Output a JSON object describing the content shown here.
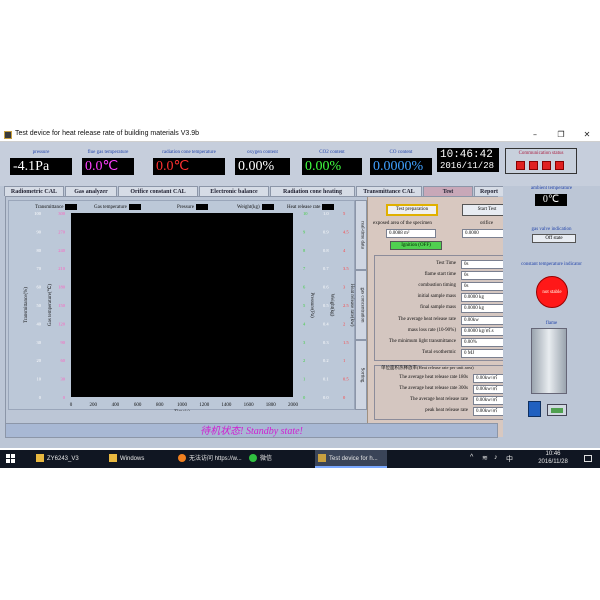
{
  "window": {
    "title": "Test device for heat release rate of building materials V3.9b",
    "controls": [
      "–",
      "❐",
      "✕"
    ]
  },
  "gauges": [
    {
      "label": "pressure",
      "value": "-4.1Pa",
      "color": "#ffffff"
    },
    {
      "label": "flue gas temperature",
      "value": "0.0℃",
      "color": "#ff40ff"
    },
    {
      "label": "radiation cone temperature",
      "value": "0.0℃",
      "color": "#ff3030"
    },
    {
      "label": "oxygen content",
      "value": "0.00%",
      "color": "#ffffff"
    },
    {
      "label": "CO2 content",
      "value": "0.00%",
      "color": "#40ff40"
    },
    {
      "label": "CO content",
      "value": "0.0000%",
      "color": "#40a0ff"
    }
  ],
  "clock": {
    "time": "10:46:42",
    "date": "2016/11/28"
  },
  "comm_status": {
    "label": "Communication status"
  },
  "tabs": [
    "Radiometric CAL",
    "Gas analyzer",
    "Orifice constant CAL",
    "Electronic balance",
    "Radiation cone heating",
    "Transmittance CAL",
    "Test",
    "Report"
  ],
  "active_tab": "Test",
  "chart": {
    "legend": [
      "Transmittance",
      "Gas temperature",
      "Pressure",
      "Weight(kg)",
      "Heat release rate"
    ],
    "xlabel": "Time(s)",
    "y_left_labels": [
      "Transmittance(%)",
      "Gas temperature(℃)"
    ],
    "y_right_labels": [
      "Pressure(Pa)",
      "Weight(kg)",
      "Heat release rate(kw)"
    ]
  },
  "chart_data": {
    "type": "line",
    "title": "",
    "xlabel": "Time(s)",
    "x_ticks": [
      0,
      200,
      400,
      600,
      800,
      1000,
      1200,
      1400,
      1600,
      1800,
      2000
    ],
    "xlim": [
      0,
      2000
    ],
    "y_axes": [
      {
        "label": "Transmittance(%)",
        "ticks": [
          0,
          10,
          20,
          30,
          40,
          50,
          60,
          70,
          80,
          90,
          100
        ],
        "color": "#ffffff"
      },
      {
        "label": "Gas temperature(℃)",
        "ticks": [
          0,
          30,
          60,
          90,
          120,
          150,
          180,
          210,
          240,
          270,
          300
        ],
        "color": "#ff60c0"
      },
      {
        "label": "Pressure(Pa)",
        "ticks": [
          0,
          1,
          2,
          3,
          4,
          5,
          6,
          7,
          8,
          9,
          10
        ],
        "color": "#40d040"
      },
      {
        "label": "Weight(kg)",
        "ticks": [
          "0.0",
          "0.1",
          "0.2",
          "0.3",
          "0.4",
          "0.5",
          "0.6",
          "0.7",
          "0.8",
          "0.9",
          "1.0"
        ],
        "color": "#ffffff"
      },
      {
        "label": "Heat release rate(kw)",
        "ticks": [
          "0",
          "0.5",
          "1",
          "1.5",
          "2",
          "2.5",
          "3",
          "3.5",
          "4",
          "4.5",
          "5"
        ],
        "color": "#ff4040"
      }
    ],
    "series": []
  },
  "vtabs": [
    "real-time data",
    "gas concentration",
    "Sorting"
  ],
  "test_panel": {
    "test_prep_btn": "Test preparation",
    "start_test_btn": "Start Test",
    "area_label": "exposed area of the specimen",
    "area_value": "0.0088 m²",
    "orifice_label": "orifice",
    "orifice_value": "0.0000",
    "ignition_btn": "Ignition (OFF)",
    "rows": [
      {
        "label": "Test Time",
        "value": "0s"
      },
      {
        "label": "flame start time",
        "value": "0s"
      },
      {
        "label": "combustion timing",
        "value": "0s"
      },
      {
        "label": "initial sample mass",
        "value": "0.0000 kg"
      },
      {
        "label": "final sample mass",
        "value": "0.0000 kg"
      },
      {
        "label": "The average heat release rate",
        "value": "0.00kw"
      },
      {
        "label": "mass loss rate (10-90%)",
        "value": "0.0000 kg/㎡.s"
      },
      {
        "label": "The minimum light transmittance",
        "value": "0.00%"
      },
      {
        "label": "Total exothermic",
        "value": "0 MJ"
      }
    ],
    "unit_area_title": "单位面积热释放率(Heat release rate per unit area)",
    "unit_area_rows": [
      {
        "label": "The average heat release rate 180s",
        "value": "0.00kw/㎡"
      },
      {
        "label": "The average heat release rate 300s",
        "value": "0.00kw/㎡"
      },
      {
        "label": "The average heat release rate",
        "value": "0.00kw/㎡"
      },
      {
        "label": "peak heat release rate",
        "value": "0.00kw/㎡"
      }
    ]
  },
  "standby": "待机状态! Standby state!",
  "side": {
    "ambient_label": "ambient temperature",
    "ambient_value": "0℃",
    "gas_valve_label": "gas valve indication",
    "gas_valve_value": "Off state",
    "constant_temp_label": "constant temperature indicator",
    "constant_temp_value": "not stable",
    "flame_label": "flame"
  },
  "taskbar": {
    "items": [
      "ZY6243_V3",
      "Windows",
      "无法访问 https://w...",
      "微信",
      "Test device for h..."
    ],
    "time": "10:46",
    "date": "2016/11/28"
  }
}
